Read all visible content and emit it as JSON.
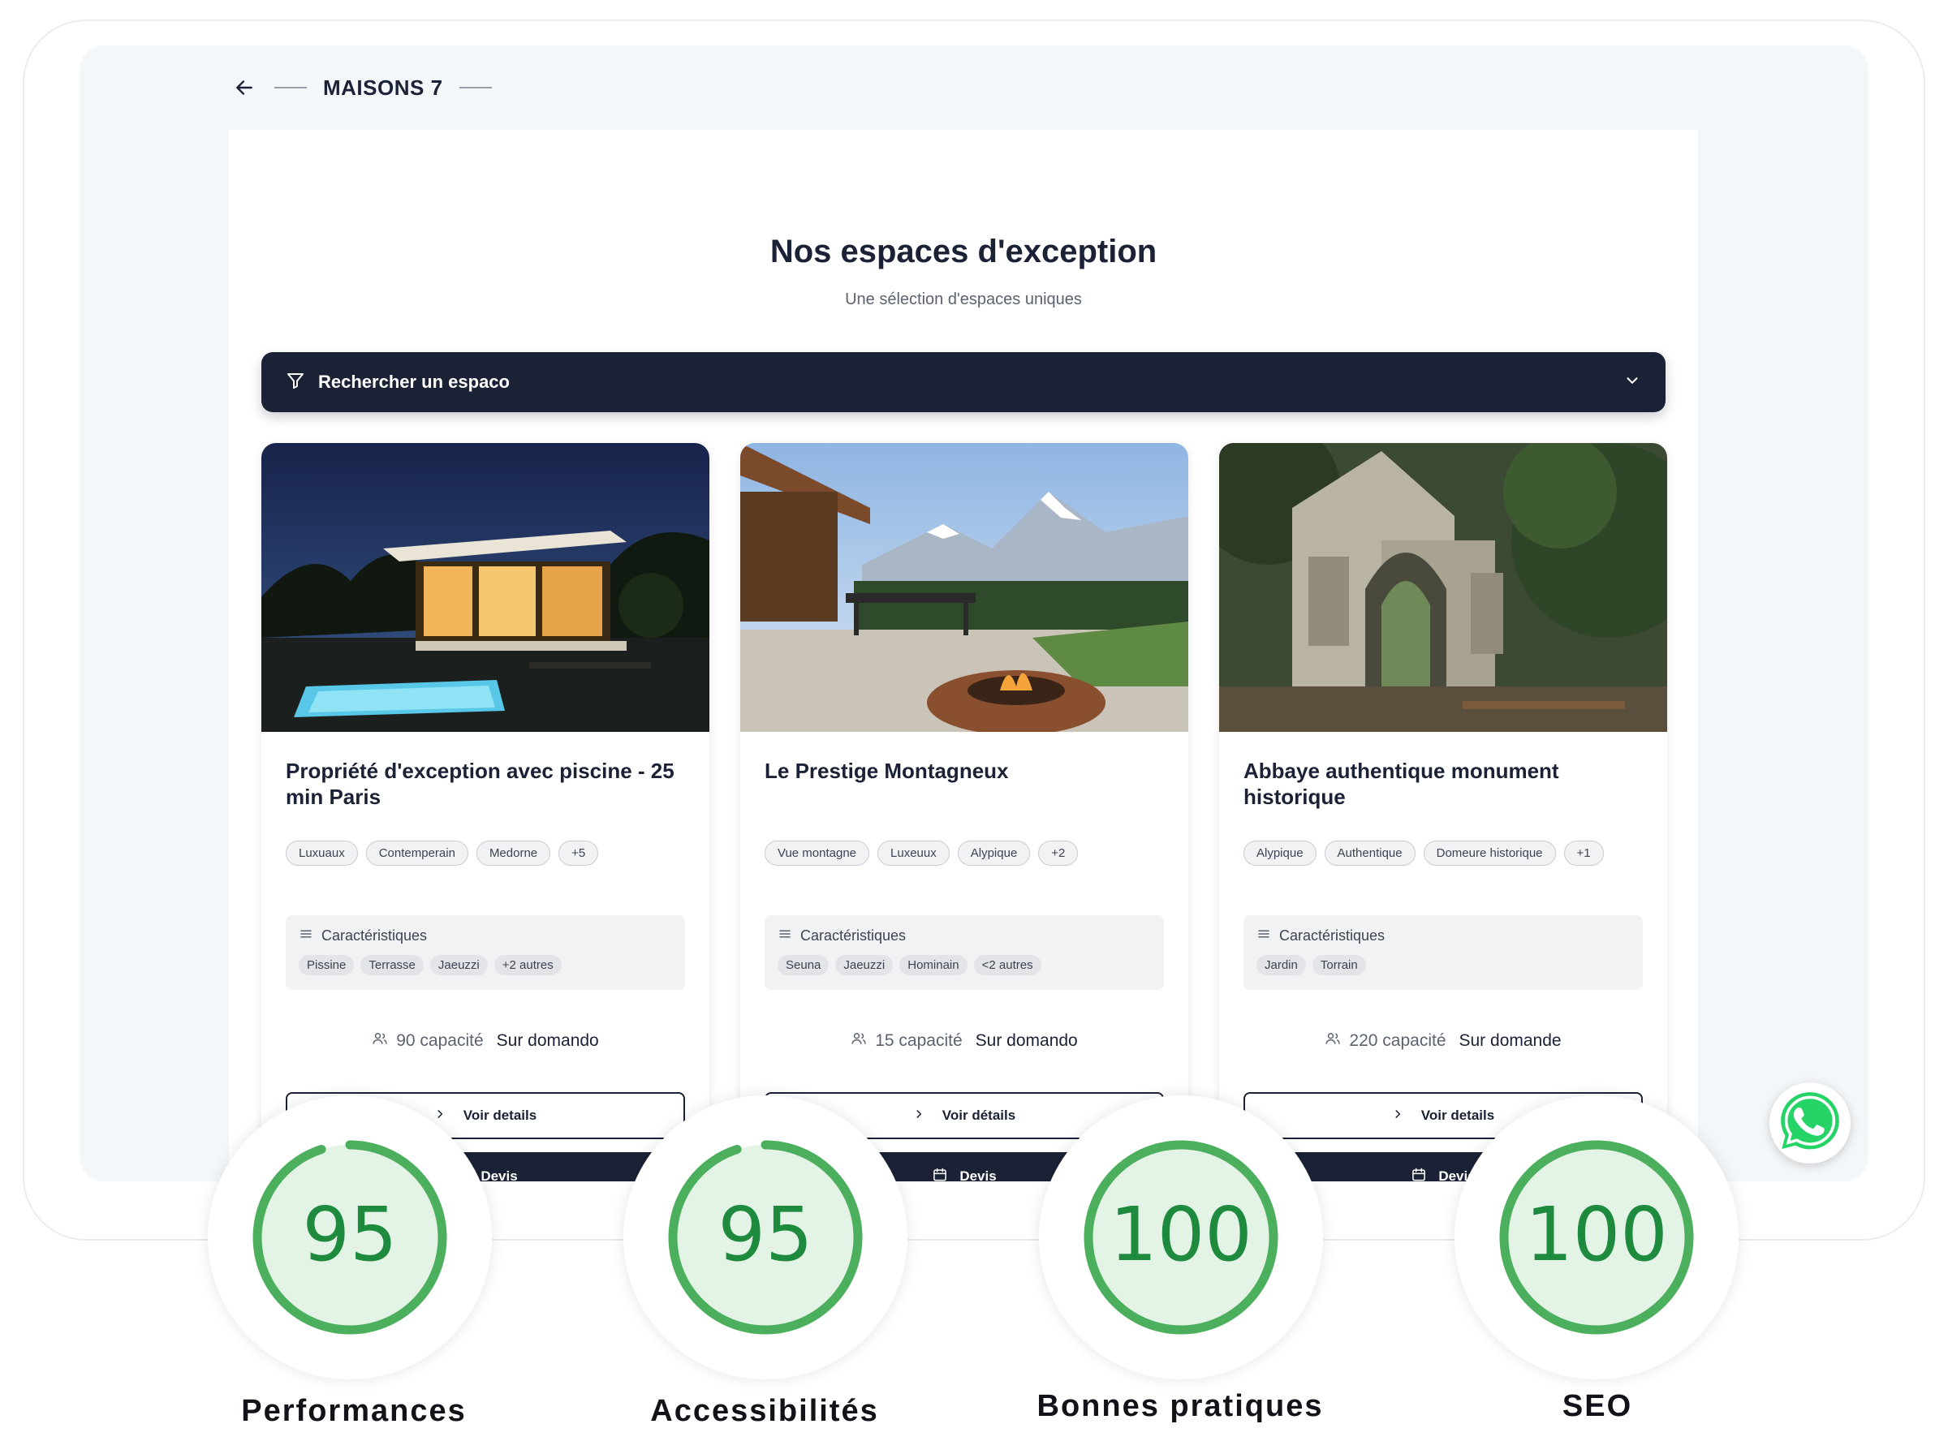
{
  "header": {
    "brand": "MAISONS 7"
  },
  "hero": {
    "title": "Nos espaces d'exception",
    "subtitle": "Une sélection d'espaces uniques"
  },
  "search": {
    "label": "Rechercher un espaco"
  },
  "cards": [
    {
      "title": "Propriété d'exception avec piscine - 25 min Paris",
      "tags": [
        "Luxuaux",
        "Contemperain",
        "Medorne",
        "+5"
      ],
      "features_label": "Caractéristiques",
      "features": [
        "Pissine",
        "Terrasse",
        "Jaeuzzi",
        "+2 autres"
      ],
      "capacity": "90 capacité",
      "price": "Sur domando",
      "details_label": "Voir details",
      "devis_label": "Devis"
    },
    {
      "title": "Le Prestige Montagneux",
      "tags": [
        "Vue montagne",
        "Luxeuux",
        "Alypique",
        "+2"
      ],
      "features_label": "Caractéristiques",
      "features": [
        "Seuna",
        "Jaeuzzi",
        "Hominain",
        "<2 autres"
      ],
      "capacity": "15 capacité",
      "price": "Sur domando",
      "details_label": "Voir détails",
      "devis_label": "Devis"
    },
    {
      "title": "Abbaye authentique monument historique",
      "tags": [
        "Alypique",
        "Authentique",
        "Domeure historique",
        "+1"
      ],
      "features_label": "Caractéristiques",
      "features": [
        "Jardin",
        "Torrain"
      ],
      "capacity": "220 capacité",
      "price": "Sur domande",
      "details_label": "Voir details",
      "devis_label": "Devis"
    }
  ],
  "scores": [
    {
      "value": 95,
      "label": "Performances"
    },
    {
      "value": 95,
      "label": "Accessibilités"
    },
    {
      "value": 100,
      "label": "Bonnes pratiques"
    },
    {
      "value": 100,
      "label": "SEO"
    }
  ],
  "colors": {
    "navy": "#1c2236",
    "score_green": "#4caf5e",
    "score_track": "#e3f3e6",
    "whatsapp": "#25d366"
  }
}
